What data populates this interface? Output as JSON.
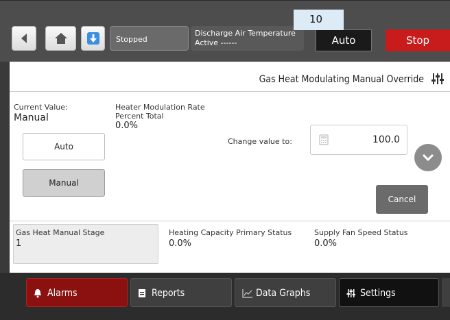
{
  "header": {
    "status": "Stopped",
    "discharge_line1": "Discharge Air Temperature",
    "discharge_line2": "Active ------",
    "auto_label": "Auto",
    "stop_label": "Stop",
    "tooltip_number": "10"
  },
  "panel": {
    "title": "Gas Heat Modulating Manual Override",
    "current_value_label": "Current Value:",
    "current_value": "Manual",
    "heater_label_line1": "Heater Modulation Rate",
    "heater_label_line2": "Percent Total",
    "heater_value": "0.0%",
    "auto_button": "Auto",
    "manual_button": "Manual",
    "change_label": "Change value to:",
    "change_value": "100.0",
    "cancel_button": "Cancel"
  },
  "status_fields": {
    "stage_label": "Gas Heat Manual Stage",
    "stage_value": "1",
    "capacity_label": "Heating Capacity Primary Status",
    "capacity_value": "0.0%",
    "fan_label": "Supply Fan Speed Status",
    "fan_value": "0.0%"
  },
  "tabs": {
    "alarms": "Alarms",
    "reports": "Reports",
    "graphs": "Data Graphs",
    "settings": "Settings"
  },
  "colors": {
    "stop_red": "#c81c1c",
    "alarms_red": "#8b1010",
    "nav_blue": "#3b8ee0"
  },
  "icons": [
    "back-arrow-icon",
    "home-icon",
    "download-arrow-icon",
    "settings-sliders-icon",
    "calculator-icon",
    "chevron-down-icon",
    "bell-icon",
    "document-icon",
    "line-chart-icon",
    "chat-icon"
  ]
}
